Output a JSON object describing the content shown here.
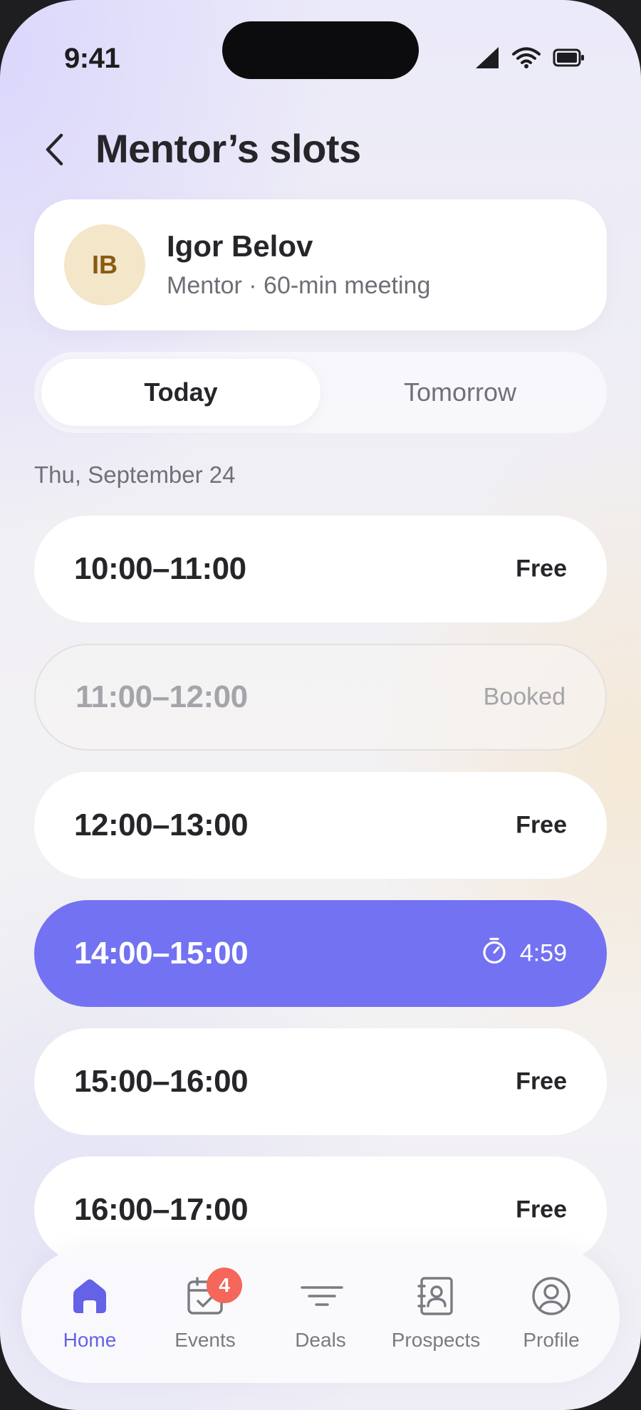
{
  "status_bar": {
    "time": "9:41"
  },
  "header": {
    "title": "Mentor’s slots"
  },
  "mentor": {
    "initials": "IB",
    "name": "Igor Belov",
    "subtitle": "Mentor · 60-min meeting"
  },
  "tabs": [
    {
      "label": "Today",
      "selected": true
    },
    {
      "label": "Tomorrow",
      "selected": false
    }
  ],
  "date": "Thu, September 24",
  "slots": [
    {
      "time": "10:00–11:00",
      "status": "Free"
    },
    {
      "time": "11:00–12:00",
      "status": "Booked"
    },
    {
      "time": "12:00–13:00",
      "status": "Free"
    },
    {
      "time": "14:00–15:00",
      "status": "4:59",
      "icon": "timer-icon"
    },
    {
      "time": "15:00–16:00",
      "status": "Free"
    },
    {
      "time": "16:00–17:00",
      "status": "Free"
    }
  ],
  "nav": [
    {
      "label": "Home",
      "icon": "home-icon",
      "active": true
    },
    {
      "label": "Events",
      "icon": "calendar-check-icon",
      "badge": "4"
    },
    {
      "label": "Deals",
      "icon": "filter-icon"
    },
    {
      "label": "Prospects",
      "icon": "contacts-icon"
    },
    {
      "label": "Profile",
      "icon": "user-circle-icon"
    }
  ],
  "colors": {
    "accent": "#7372f2",
    "nav_active": "#6462e6",
    "badge": "#f4675a",
    "avatar_bg": "#f3e6c9"
  }
}
